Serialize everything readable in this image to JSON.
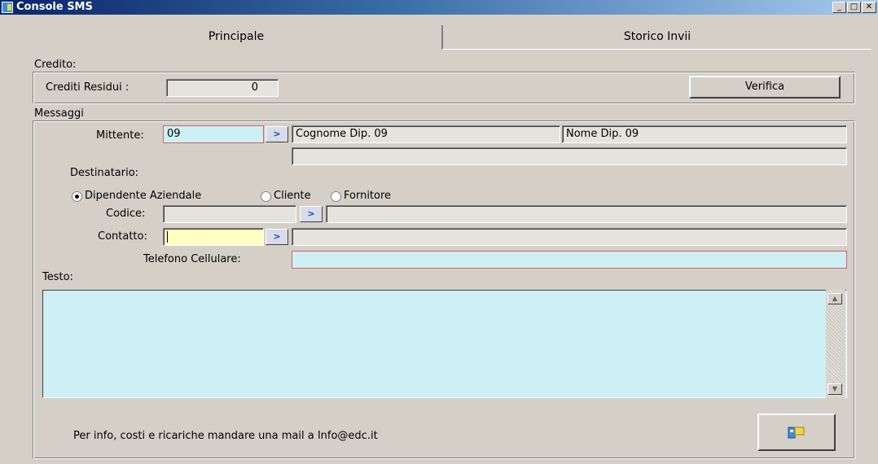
{
  "window": {
    "title": "Console SMS"
  },
  "tabs": [
    {
      "label": "Principale"
    },
    {
      "label": "Storico Invii"
    }
  ],
  "credito": {
    "section_label": "Credito:",
    "crediti_label": "Crediti Residui :",
    "crediti_value": "0",
    "verifica_label": "Verifica"
  },
  "messaggi": {
    "section_label": "Messaggi",
    "mittente_label": "Mittente:",
    "mittente_value": "09",
    "mittente_cognome": "Cognome Dip. 09",
    "mittente_nome": "Nome Dip. 09",
    "destinatario_label": "Destinatario:",
    "radio_options": [
      "Dipendente Aziendale",
      "Cliente",
      "Fornitore"
    ],
    "radio_selected": "Dipendente Aziendale",
    "codice_label": "Codice:",
    "contatto_label": "Contatto:",
    "telefono_label": "Telefono Cellulare:",
    "testo_label": "Testo:",
    "info_text": "Per info, costi e ricariche mandare una mail a Info@edc.it"
  },
  "icons": {
    "app": "sms-console-icon",
    "send": "send-sms-icon",
    "lookup": "arrow-right-icon"
  },
  "colors": {
    "field_cyan": "#cdf0f4",
    "field_yellow": "#ffffc0",
    "title_bar": "#0a246a"
  }
}
